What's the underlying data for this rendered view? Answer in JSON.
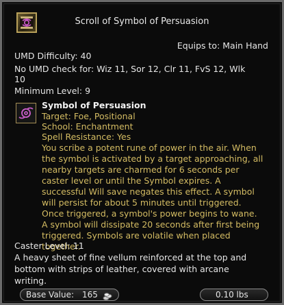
{
  "item": {
    "title": "Scroll of Symbol of Persuasion",
    "icon": "scroll-icon",
    "equips_to": "Equips to: Main Hand"
  },
  "requirements": {
    "umd_difficulty": "UMD Difficulty: 40",
    "no_umd_line1": "No UMD check for: Wiz 11, Sor 12, Clr 11, FvS 12, Wlk",
    "no_umd_line2": "10",
    "minimum_level": "Minimum Level: 9"
  },
  "spell": {
    "icon": "symbol-icon",
    "name": "Symbol of Persuasion",
    "target": "Target: Foe, Positional",
    "school": "School: Enchantment",
    "spell_resistance": "Spell Resistance: Yes",
    "description": "You scribe a potent rune of power in the air. When\nthe symbol is activated by a target approaching, all\nnearby targets are charmed for 6 seconds per\ncaster level or until the Symbol expires. A\nsuccessful Will save negates this effect. A symbol\nwill persist for about 5 minutes until triggered.\nOnce triggered, a symbol's power begins to wane.\n A symbol will dissipate 20 seconds after first being\ntriggered. Symbols are volatile when placed\ntogether."
  },
  "caster_level": "Caster Level: 11",
  "flavor_text": "A heavy sheet of fine vellum reinforced at the top and\nbottom with strips of leather, covered with arcane\nwriting.",
  "footer": {
    "base_value_label": "Base Value:",
    "base_value": "165",
    "coin_icon": "coin-icon",
    "weight": "0.10 lbs"
  },
  "colors": {
    "spell_text": "#d4bc63",
    "primary_text": "#e6e6e6",
    "border": "#6b6b6b"
  }
}
